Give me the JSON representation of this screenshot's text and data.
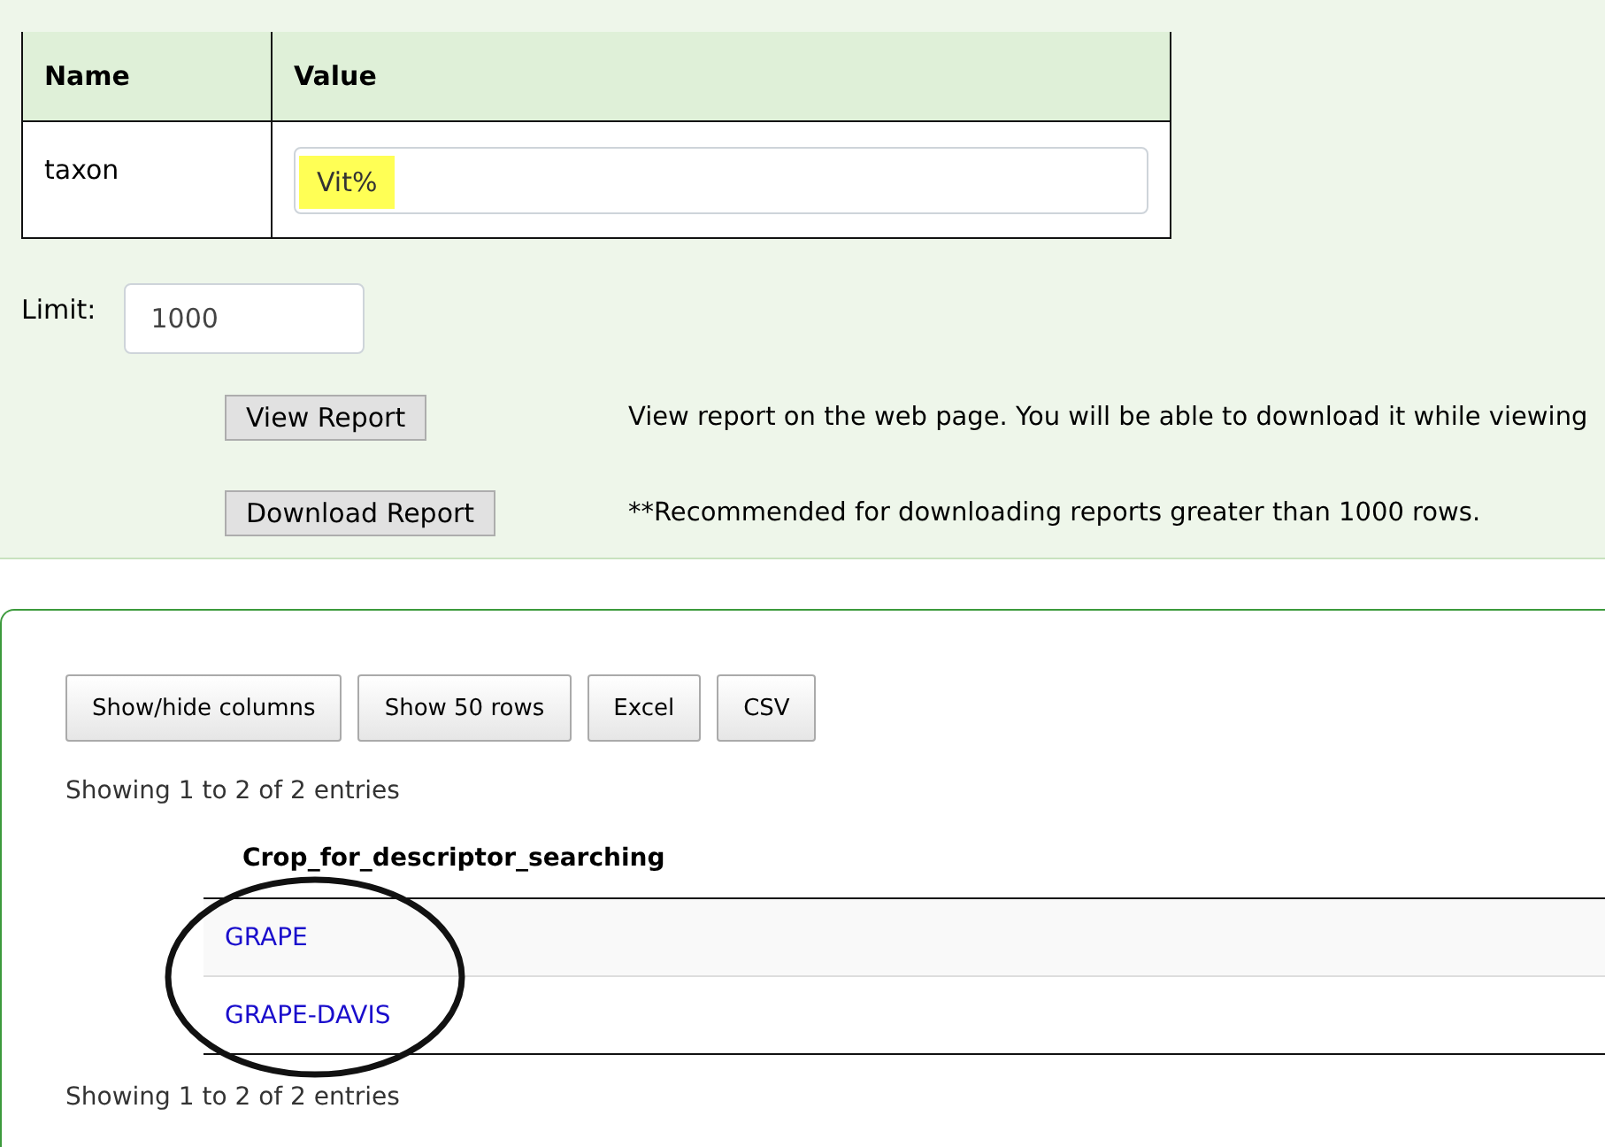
{
  "criteria_table": {
    "columns": [
      "Name",
      "Value"
    ],
    "rows": [
      {
        "name": "taxon",
        "value": "Vit%",
        "highlighted": true
      }
    ]
  },
  "limit": {
    "label": "Limit:",
    "value": "1000"
  },
  "actions": [
    {
      "button": "View Report",
      "description": "View report on the web page. You will be able to download it while viewing"
    },
    {
      "button": "Download Report",
      "description": "**Recommended for downloading reports greater than 1000 rows."
    }
  ],
  "results": {
    "buttons": [
      "Show/hide columns",
      "Show 50 rows",
      "Excel",
      "CSV"
    ],
    "info_top": "Showing 1 to 2 of 2 entries",
    "columns": [
      "Crop_for_descriptor_searching"
    ],
    "rows": [
      {
        "cells": [
          "GRAPE"
        ]
      },
      {
        "cells": [
          "GRAPE-DAVIS"
        ]
      }
    ],
    "info_bottom": "Showing 1 to 2 of 2 entries",
    "annotation": {
      "kind": "circle"
    }
  }
}
